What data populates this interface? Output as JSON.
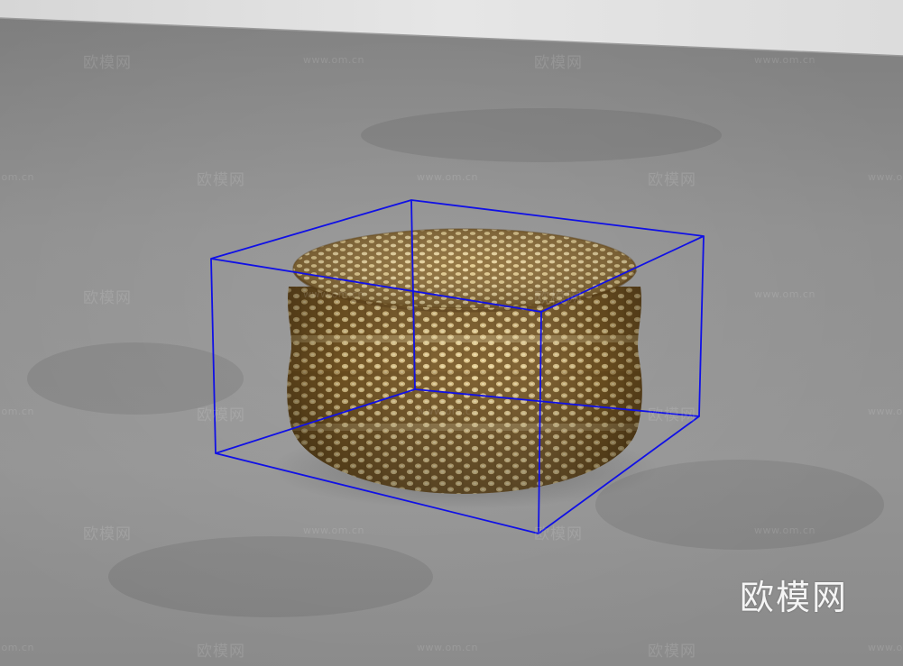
{
  "scene": {
    "object": "woven-round-pouf",
    "selection_box_color": "#1010e6",
    "floor_color": "#8c8c8c",
    "wall_color": "#e2e2e2",
    "pouf_base_color": "#8a6a30",
    "pouf_highlight_color": "#e6cf96"
  },
  "watermark": {
    "brand": "欧模网",
    "url": "www.om.cn"
  }
}
